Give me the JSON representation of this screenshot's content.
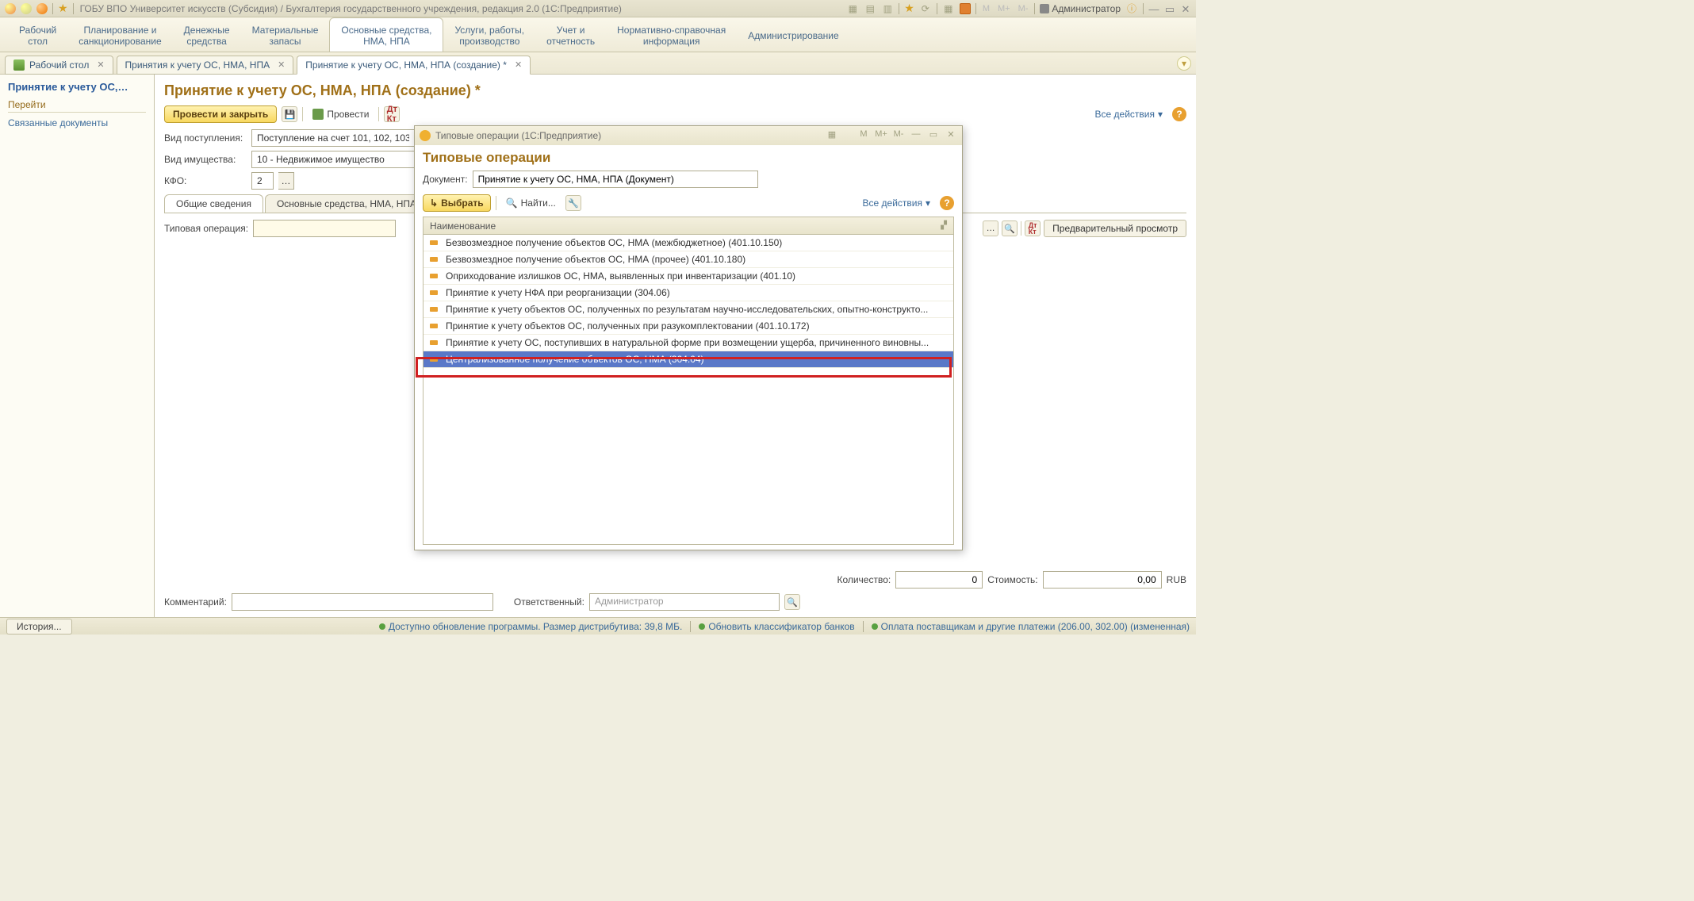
{
  "titlebar": {
    "title": "ГОБУ ВПО Университет искусств (Субсидия) / Бухгалтерия государственного учреждения, редакция 2.0  (1С:Предприятие)",
    "user": "Администратор",
    "m": "M",
    "mplus": "M+",
    "mminus": "M-"
  },
  "sections": [
    "Рабочий\nстол",
    "Планирование и\nсанкционирование",
    "Денежные\nсредства",
    "Материальные\nзапасы",
    "Основные средства,\nНМА, НПА",
    "Услуги, работы,\nпроизводство",
    "Учет и\nотчетность",
    "Нормативно-справочная\nинформация",
    "Администрирование"
  ],
  "sections_active": 4,
  "wintabs": [
    {
      "label": "Рабочий стол",
      "icon": true
    },
    {
      "label": "Принятия к учету ОС, НМА, НПА"
    },
    {
      "label": "Принятие к учету ОС, НМА, НПА (создание) *",
      "active": true
    }
  ],
  "leftpanel": {
    "heading": "Принятие к учету ОС,…",
    "group": "Перейти",
    "link": "Связанные документы"
  },
  "main": {
    "heading": "Принятие к учету ОС, НМА, НПА (создание) *",
    "btn_post_close": "Провести и закрыть",
    "btn_post": "Провести",
    "all_actions": "Все действия",
    "row1_lbl": "Вид поступления:",
    "row1_val": "Поступление на счет 101, 102, 103",
    "row2_lbl": "Вид имущества:",
    "row2_val": "10 - Недвижимое имущество",
    "row3_lbl": "КФО:",
    "row3_val": "2",
    "subtabs": [
      "Общие сведения",
      "Основные средства, НМА, НПА"
    ],
    "subtabs_active": 0,
    "typ_lbl": "Типовая операция:",
    "preview_btn": "Предварительный просмотр",
    "qty_lbl": "Количество:",
    "qty_val": "0",
    "cost_lbl": "Стоимость:",
    "cost_val": "0,00",
    "cur": "RUB",
    "comment_lbl": "Комментарий:",
    "resp_lbl": "Ответственный:",
    "resp_val": "Администратор"
  },
  "modal": {
    "title": "Типовые операции  (1С:Предприятие)",
    "m": "M",
    "mplus": "M+",
    "mminus": "M-",
    "heading": "Типовые операции",
    "doc_lbl": "Документ:",
    "doc_val": "Принятие к учету ОС, НМА, НПА (Документ)",
    "select_btn": "Выбрать",
    "find_btn": "Найти...",
    "all_actions": "Все действия",
    "col": "Наименование",
    "rows": [
      "Безвозмездное получение объектов ОС, НМА (межбюджетное) (401.10.150)",
      "Безвозмездное получение объектов ОС, НМА (прочее) (401.10.180)",
      "Оприходование излишков ОС, НМА, выявленных при инвентаризации (401.10)",
      "Принятие к учету НФА при реорганизации (304.06)",
      "Принятие к учету объектов ОС, полученных по результатам научно-исследовательских, опытно-конструкто...",
      "Принятие к учету объектов ОС, полученных при разукомплектовании (401.10.172)",
      "Принятие к учету ОС, поступивших в натуральной форме при возмещении ущерба, причиненного виновны...",
      "Централизованное получение объектов ОС, НМА (304.04)"
    ],
    "selected": 7
  },
  "statusbar": {
    "history": "История...",
    "s1": "Доступно обновление программы. Размер дистрибутива: 39,8 МБ.",
    "s2": "Обновить классификатор банков",
    "s3": "Оплата поставщикам и другие платежи (206.00, 302.00) (измененная)"
  }
}
